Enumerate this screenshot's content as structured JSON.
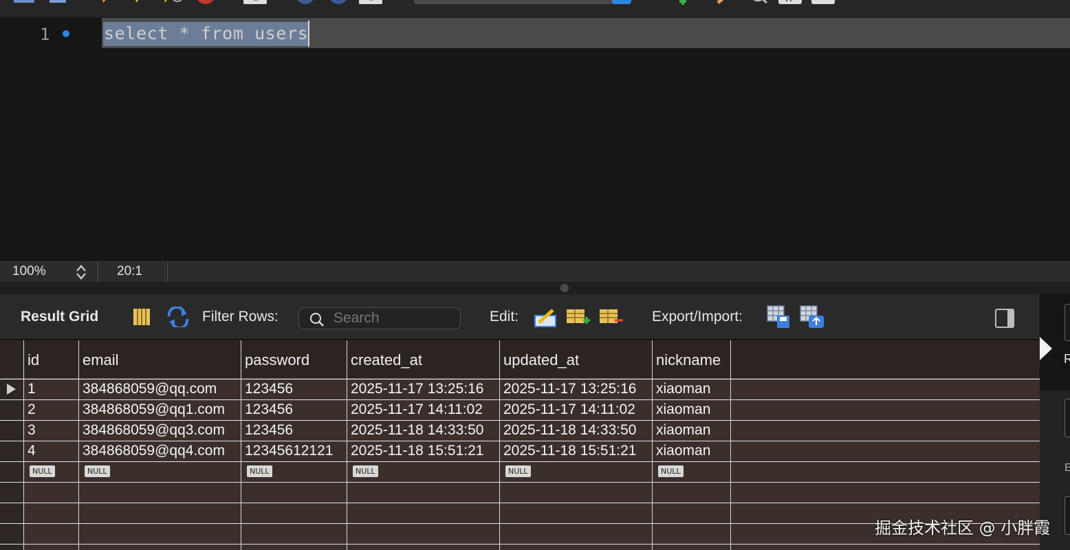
{
  "editor": {
    "line_number": "1",
    "code": "select * from users"
  },
  "status": {
    "zoom": "100%",
    "cursor": "20:1"
  },
  "results_toolbar": {
    "title": "Result Grid",
    "filter_label": "Filter Rows:",
    "search_placeholder": "Search",
    "edit_label": "Edit:",
    "export_label": "Export/Import:"
  },
  "side_panel": {
    "letter_r": "R",
    "letter_e": "E"
  },
  "grid": {
    "columns": [
      "id",
      "email",
      "password",
      "created_at",
      "updated_at",
      "nickname"
    ],
    "rows": [
      [
        "1",
        "384868059@qq.com",
        "123456",
        "2025-11-17 13:25:16",
        "2025-11-17 13:25:16",
        "xiaoman"
      ],
      [
        "2",
        "384868059@qq1.com",
        "123456",
        "2025-11-17 14:11:02",
        "2025-11-17 14:11:02",
        "xiaoman"
      ],
      [
        "3",
        "384868059@qq3.com",
        "123456",
        "2025-11-18 14:33:50",
        "2025-11-18 14:33:50",
        "xiaoman"
      ],
      [
        "4",
        "384868059@qq4.com",
        "12345612121",
        "2025-11-18 15:51:21",
        "2025-11-18 15:51:21",
        "xiaoman"
      ]
    ],
    "null_label": "NULL"
  },
  "watermark": "掘金技术社区 @ 小胖霞",
  "colors": {
    "accent": "#2b86e3",
    "selection": "#6b7d97",
    "grid_bg": "#3a2f2b"
  }
}
